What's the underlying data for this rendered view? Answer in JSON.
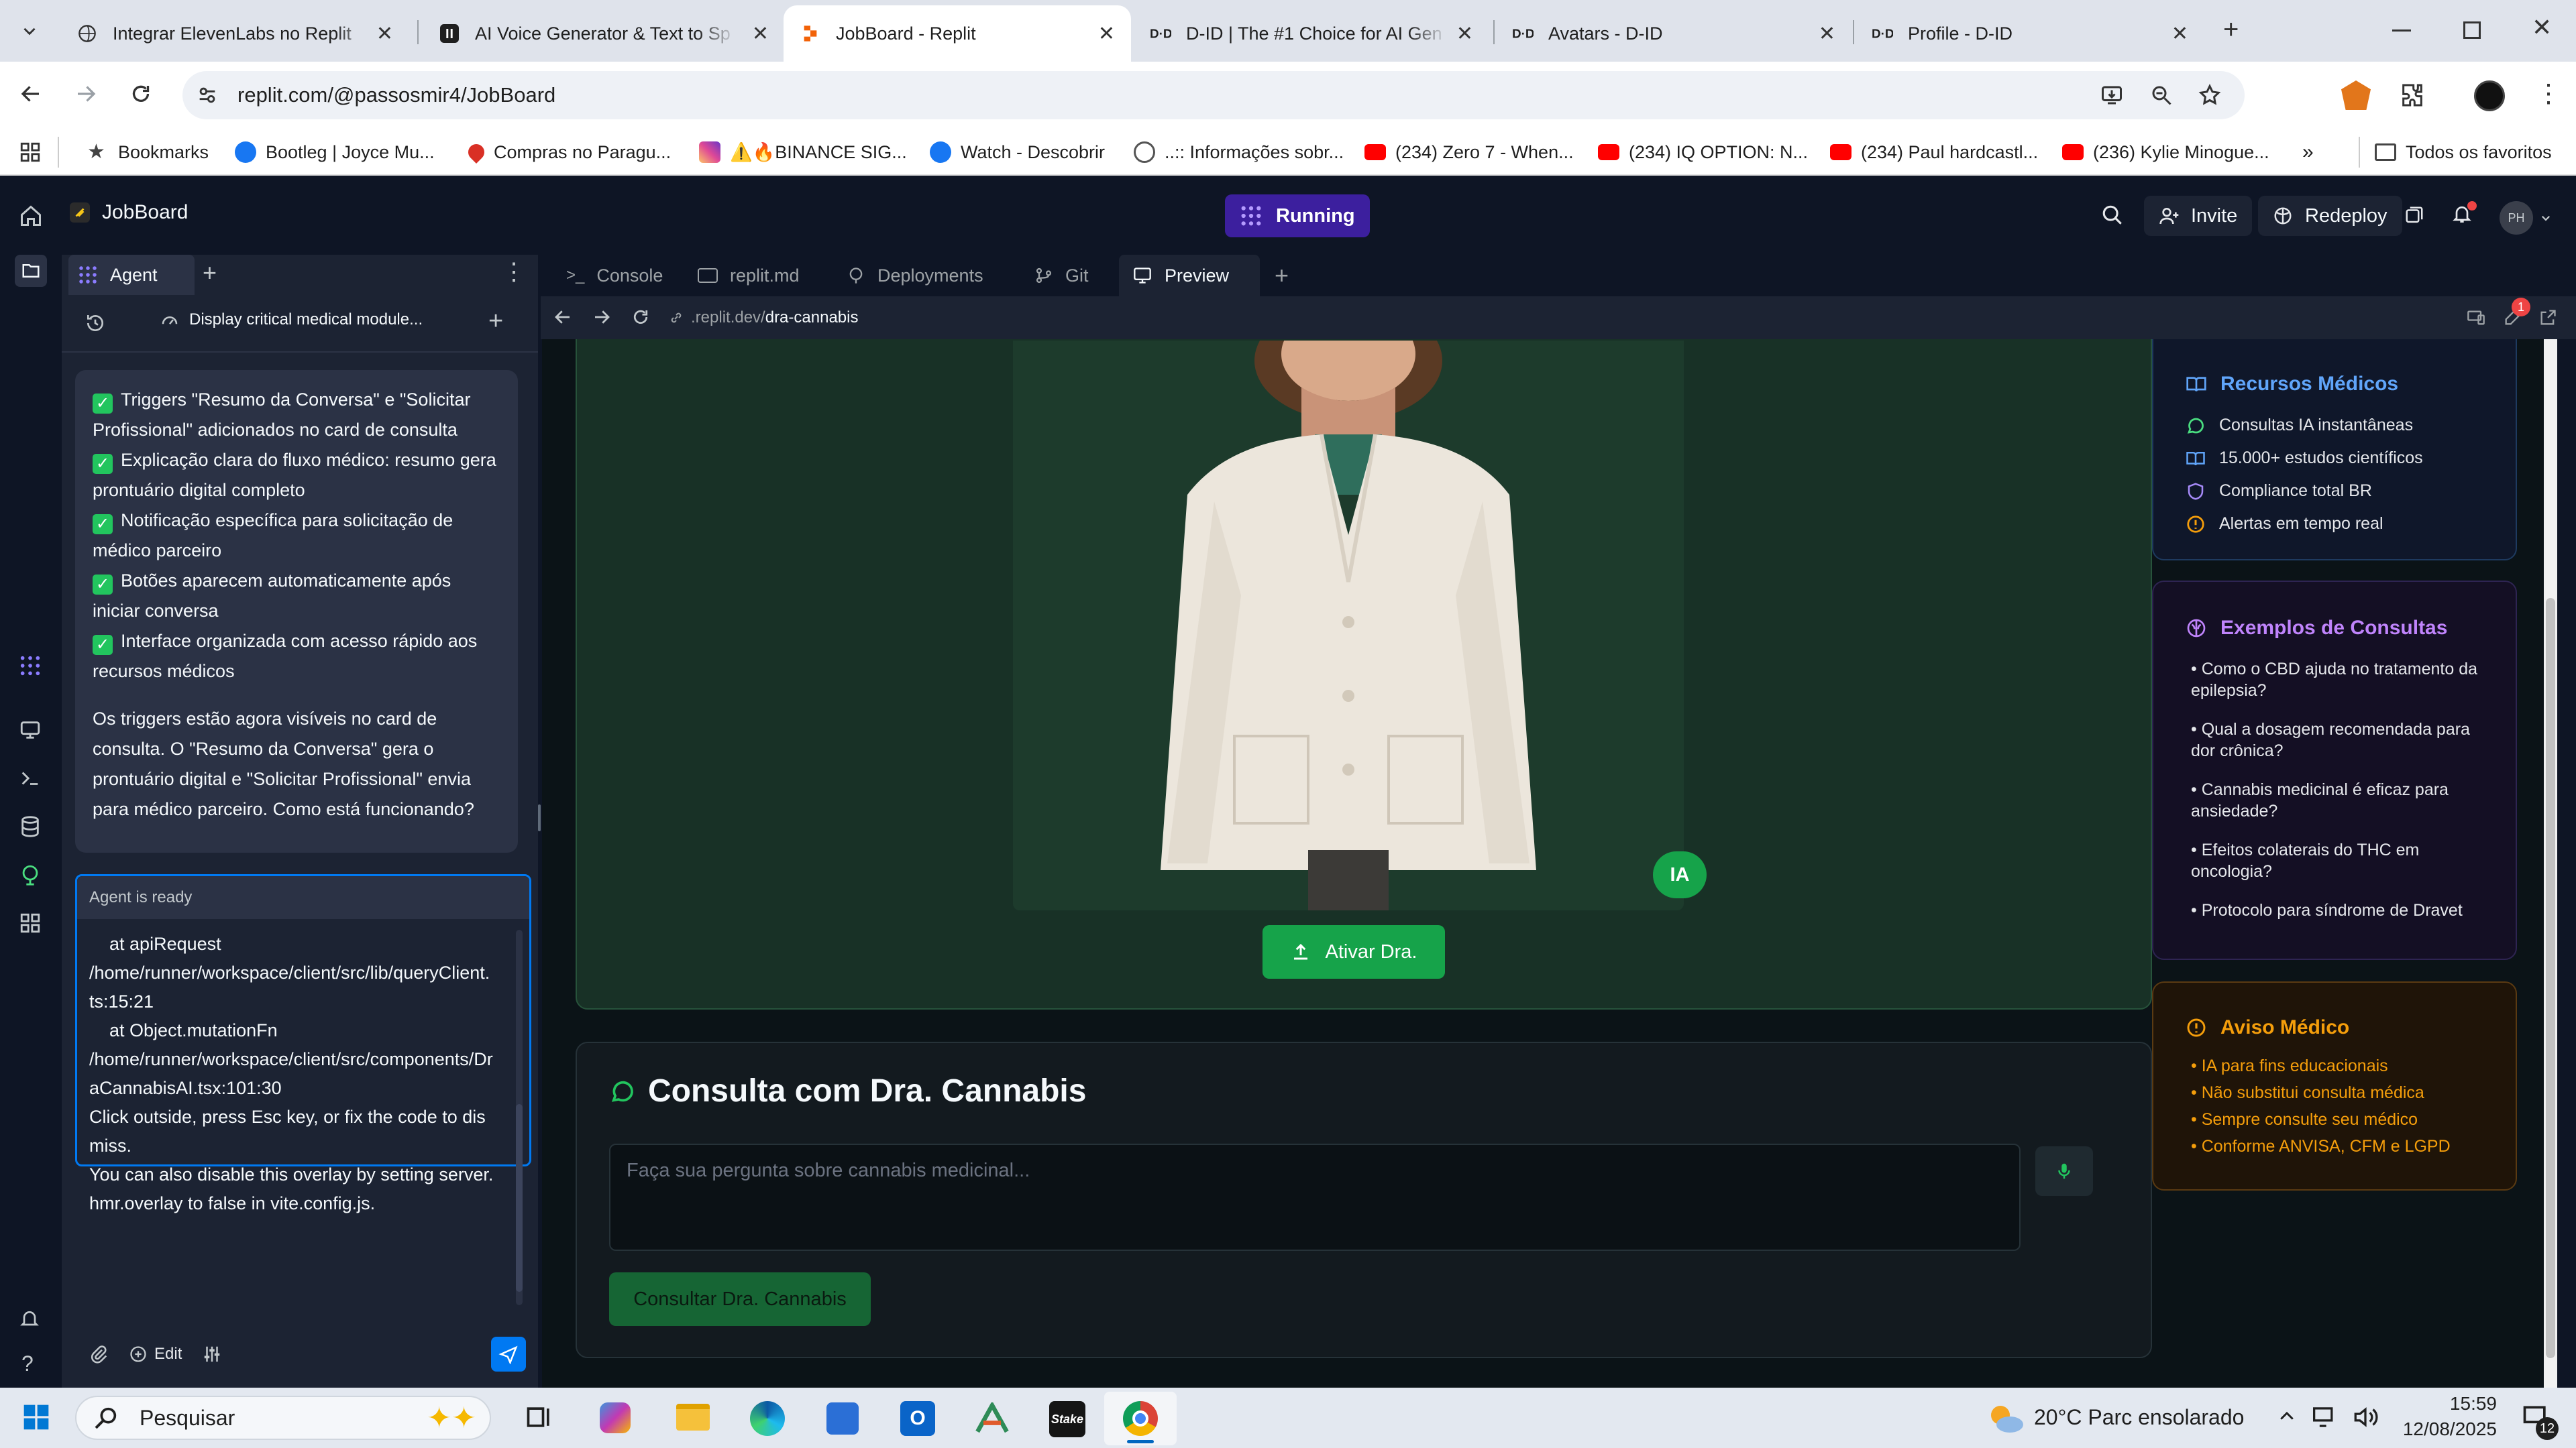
{
  "browser": {
    "tabs": [
      {
        "title": "Integrar ElevenLabs no Replit",
        "icon": "replit-favicon-icon",
        "active": false
      },
      {
        "title": "AI Voice Generator & Text to Sp",
        "icon": "elevenlabs-favicon-icon",
        "active": false
      },
      {
        "title": "JobBoard - Replit",
        "icon": "replit-favicon-icon",
        "active": true
      },
      {
        "title": "D-ID | The #1 Choice for AI Gen",
        "icon": "did-favicon-icon",
        "active": false
      },
      {
        "title": "Avatars - D-ID",
        "icon": "did-favicon-icon",
        "active": false
      },
      {
        "title": "Profile - D-ID",
        "icon": "did-favicon-icon",
        "active": false
      }
    ],
    "url": "replit.com/@passosmir4/JobBoard",
    "bookmarks": [
      {
        "label": "Bookmarks",
        "icon": "star-icon"
      },
      {
        "label": "Bootleg | Joyce Mu...",
        "icon": "facebook-icon"
      },
      {
        "label": "Compras no Paragu...",
        "icon": "map-pin-icon"
      },
      {
        "label": "⚠️🔥BINANCE SIG...",
        "icon": "instagram-icon"
      },
      {
        "label": "Watch - Descobrir",
        "icon": "facebook-icon"
      },
      {
        "label": "..:: Informações sobr...",
        "icon": "globe-icon"
      },
      {
        "label": "(234) Zero 7 - When...",
        "icon": "youtube-icon"
      },
      {
        "label": "(234) IQ OPTION: N...",
        "icon": "youtube-icon"
      },
      {
        "label": "(234) Paul hardcastl...",
        "icon": "youtube-icon"
      },
      {
        "label": "(236) Kylie Minogue...",
        "icon": "youtube-icon"
      }
    ],
    "all_bookmarks": "Todos os favoritos"
  },
  "replit": {
    "project_name": "JobBoard",
    "run_status": "Running",
    "invite": "Invite",
    "redeploy": "Redeploy",
    "avatar_initials": "PH",
    "notification_count": "1"
  },
  "agent": {
    "tab_label": "Agent",
    "thread_title": "Display critical medical module...",
    "message_items": [
      "Triggers \"Resumo da Conversa\" e \"Solicitar Profissional\" adicionados no card de consulta",
      "Explicação clara do fluxo médico: resumo gera prontuário digital completo",
      "Notificação específica para solicitação de médico parceiro",
      "Botões aparecem automaticamente após iniciar conversa",
      "Interface organizada com acesso rápido aos recursos médicos"
    ],
    "message_summary": "Os triggers estão agora visíveis no card de consulta. O \"Resumo da Conversa\" gera o prontuário digital e \"Solicitar Profissional\" envia para médico parceiro. Como está funcionando?",
    "status": "Agent is ready",
    "input_text": "    at apiRequest\n/home/runner/workspace/client/src/lib/queryClient.ts:15:21\n    at Object.mutationFn\n/home/runner/workspace/client/src/components/DraCannabisAI.tsx:101:30\nClick outside, press Esc key, or fix the code to dismiss.\nYou can also disable this overlay by setting server.hmr.overlay to false in vite.config.js.",
    "edit_label": "Edit"
  },
  "workspace": {
    "tabs": [
      "Console",
      "replit.md",
      "Deployments",
      "Git",
      "Preview"
    ],
    "preview_url_prefix": ".replit.dev/",
    "preview_url_path": "dra-cannabis",
    "preview_badge_count": "1"
  },
  "app": {
    "ia_badge": "IA",
    "activate_button": "Ativar Dra.",
    "consult_title": "Consulta com Dra. Cannabis",
    "question_placeholder": "Faça sua pergunta sobre cannabis medicinal...",
    "consult_button": "Consultar Dra. Cannabis",
    "resources_title": "Recursos Médicos",
    "resources": [
      {
        "label": "Consultas IA instantâneas",
        "icon": "chat-icon",
        "color": "#4ade80"
      },
      {
        "label": "15.000+ estudos científicos",
        "icon": "book-icon",
        "color": "#60a5fa"
      },
      {
        "label": "Compliance total BR",
        "icon": "shield-icon",
        "color": "#a78bfa"
      },
      {
        "label": "Alertas em tempo real",
        "icon": "alert-circle-icon",
        "color": "#f59e0b"
      }
    ],
    "examples_title": "Exemplos de Consultas",
    "examples": [
      "• Como o CBD ajuda no tratamento da epilepsia?",
      "• Qual a dosagem recomendada para dor crônica?",
      "• Cannabis medicinal é eficaz para ansiedade?",
      "• Efeitos colaterais do THC em oncologia?",
      "• Protocolo para síndrome de Dravet"
    ],
    "warning_title": "Aviso Médico",
    "warnings": [
      "• IA para fins educacionais",
      "• Não substitui consulta médica",
      "• Sempre consulte seu médico",
      "• Conforme ANVISA, CFM e LGPD"
    ],
    "colors": {
      "green": "#16a34a",
      "blue": "#60a5fa",
      "purple": "#c084fc",
      "orange": "#f59e0b"
    }
  },
  "taskbar": {
    "search_placeholder": "Pesquisar",
    "weather": "20°C  Parc ensolarado",
    "time": "15:59",
    "date": "12/08/2025",
    "notification_count": "12"
  }
}
